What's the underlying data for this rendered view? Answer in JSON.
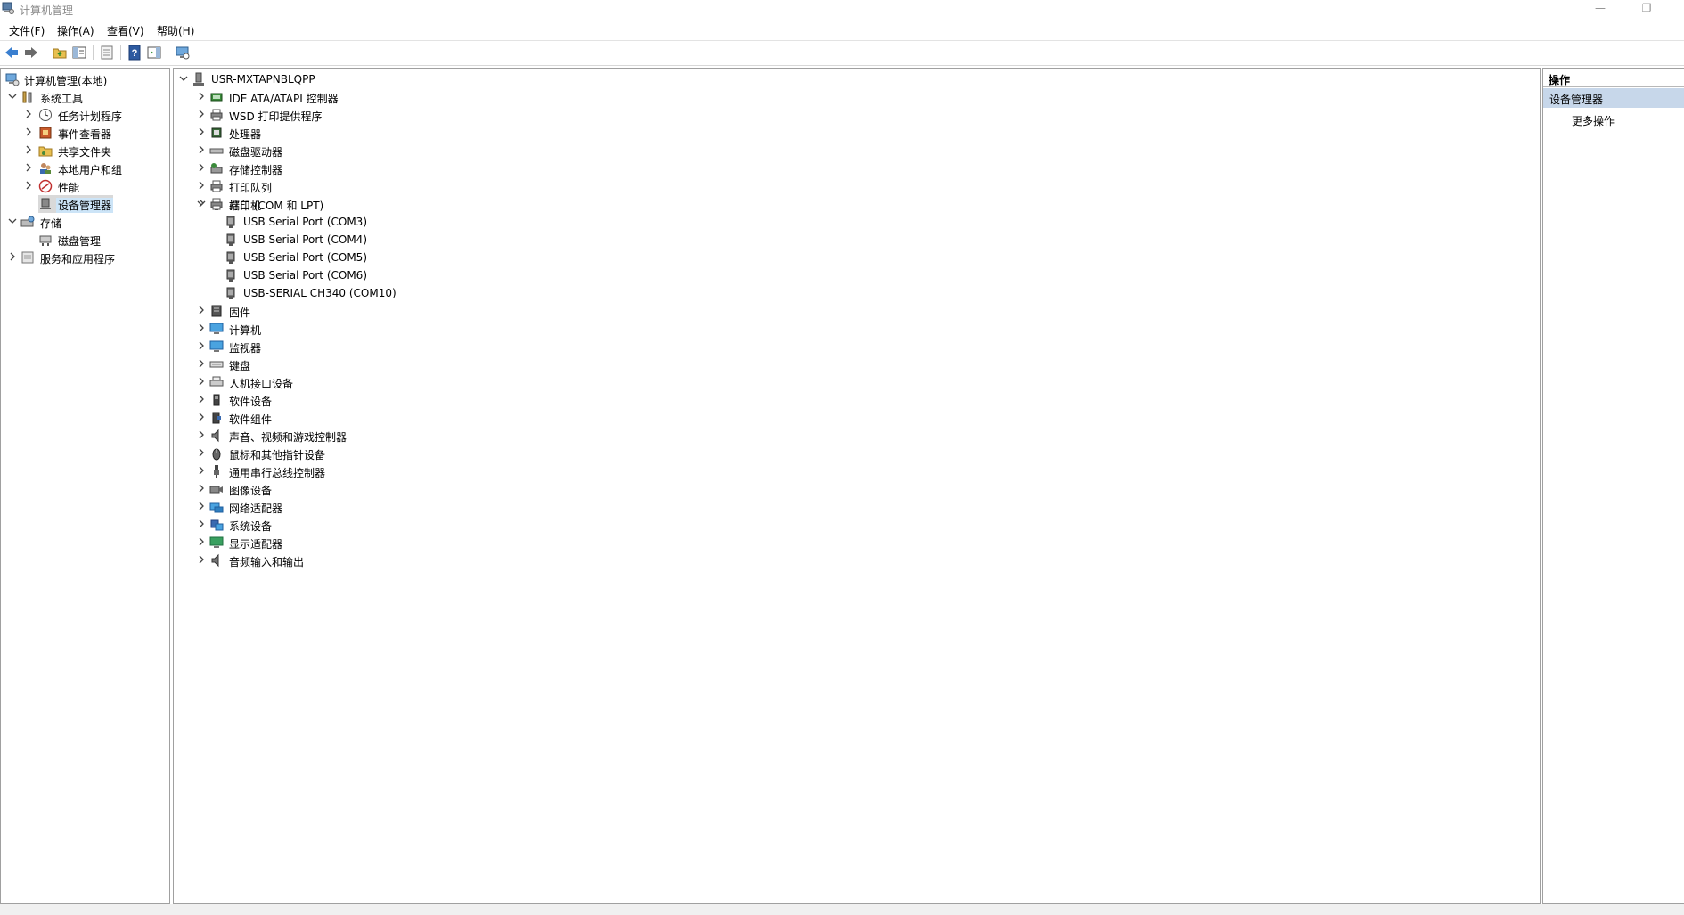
{
  "window": {
    "title": "计算机管理",
    "minimize_glyph": "—",
    "restore_glyph": "❐"
  },
  "menu": [
    "文件(F)",
    "操作(A)",
    "查看(V)",
    "帮助(H)"
  ],
  "left_tree": {
    "root": "计算机管理(本地)",
    "system_tools": "系统工具",
    "task_scheduler": "任务计划程序",
    "event_viewer": "事件查看器",
    "shared_folders": "共享文件夹",
    "local_users": "本地用户和组",
    "performance": "性能",
    "device_manager": "设备管理器",
    "storage": "存储",
    "disk_management": "磁盘管理",
    "services_apps": "服务和应用程序"
  },
  "device_tree": {
    "computer_name": "USR-MXTAPNBLQPP",
    "categories": [
      {
        "label": "IDE ATA/ATAPI 控制器",
        "icon": "ide-controller-icon"
      },
      {
        "label": "WSD 打印提供程序",
        "icon": "printer-icon"
      },
      {
        "label": "处理器",
        "icon": "processor-icon"
      },
      {
        "label": "磁盘驱动器",
        "icon": "disk-drive-icon"
      },
      {
        "label": "存储控制器",
        "icon": "storage-controller-icon"
      },
      {
        "label": "打印队列",
        "icon": "print-queue-icon"
      },
      {
        "label": "打印机",
        "icon": "printer-icon"
      }
    ],
    "ports": {
      "label": "端口 (COM 和 LPT)",
      "children": [
        "USB Serial Port (COM3)",
        "USB Serial Port (COM4)",
        "USB Serial Port (COM5)",
        "USB Serial Port (COM6)",
        "USB-SERIAL CH340 (COM10)"
      ]
    },
    "categories_after": [
      {
        "label": "固件",
        "icon": "firmware-icon"
      },
      {
        "label": "计算机",
        "icon": "computer-icon"
      },
      {
        "label": "监视器",
        "icon": "monitor-icon"
      },
      {
        "label": "键盘",
        "icon": "keyboard-icon"
      },
      {
        "label": "人机接口设备",
        "icon": "hid-icon"
      },
      {
        "label": "软件设备",
        "icon": "software-device-icon"
      },
      {
        "label": "软件组件",
        "icon": "software-component-icon"
      },
      {
        "label": "声音、视频和游戏控制器",
        "icon": "sound-icon"
      },
      {
        "label": "鼠标和其他指针设备",
        "icon": "mouse-icon"
      },
      {
        "label": "通用串行总线控制器",
        "icon": "usb-icon"
      },
      {
        "label": "图像设备",
        "icon": "camera-icon"
      },
      {
        "label": "网络适配器",
        "icon": "network-adapter-icon"
      },
      {
        "label": "系统设备",
        "icon": "system-device-icon"
      },
      {
        "label": "显示适配器",
        "icon": "display-adapter-icon"
      },
      {
        "label": "音频输入和输出",
        "icon": "audio-io-icon"
      }
    ]
  },
  "actions": {
    "header": "操作",
    "section": "设备管理器",
    "more": "更多操作"
  },
  "colors": {
    "selected_section": "#c7d7ea",
    "selected_row": "#d9d9d9",
    "pane_border": "#a0a0a0"
  }
}
